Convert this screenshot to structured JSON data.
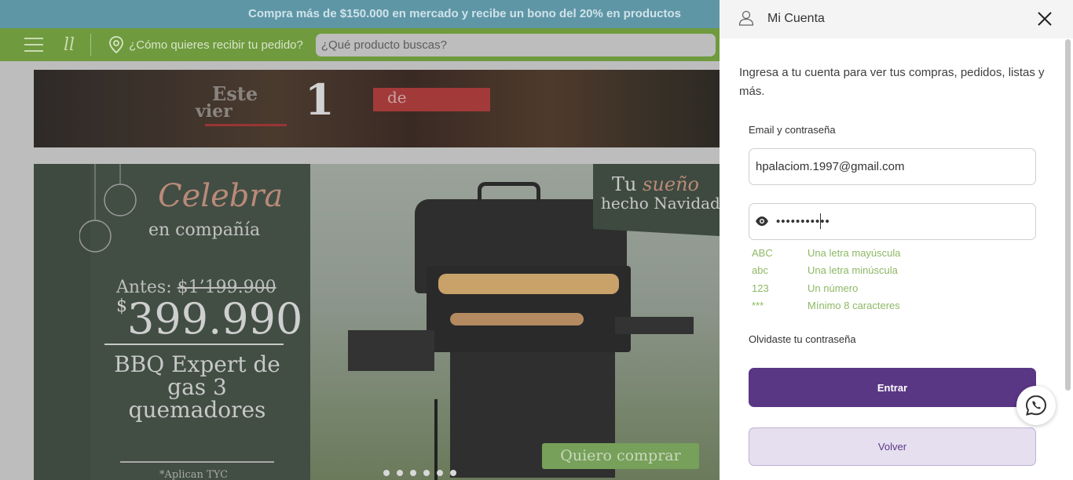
{
  "promo": {
    "text": "Compra más de $150.000 en mercado y recibe un bono del 20% en productos"
  },
  "nav": {
    "delivery_label": "¿Cómo quieres recibir tu pedido?",
    "search_placeholder": "¿Qué producto buscas?"
  },
  "banner_top": {
    "line1": "Este",
    "line2": "vier",
    "number": "1",
    "tag": "de"
  },
  "banner_main": {
    "headline": "Celebra",
    "subheadline": "en compañía",
    "before_label": "Antes:",
    "before_price": "$1’199.900",
    "price_symbol": "$",
    "price": "399.990",
    "product": "BBQ Expert de gas 3 quemadores",
    "terms": "*Aplican TYC",
    "ribbon_word1": "Tu",
    "ribbon_word2": "sueño",
    "ribbon_line2": "hecho Navidad",
    "cta": "Quiero comprar",
    "slide_count": 6
  },
  "account_panel": {
    "title": "Mi Cuenta",
    "intro": "Ingresa a tu cuenta para ver tus compras, pedidos, listas y más.",
    "credentials_label": "Email y contraseña",
    "email_value": "hpalaciom.1997@gmail.com",
    "password_value": "•••••••••••",
    "password_rules": [
      {
        "code": "ABC",
        "text": "Una letra mayúscula"
      },
      {
        "code": "abc",
        "text": "Una letra minúscula"
      },
      {
        "code": "123",
        "text": "Un número"
      },
      {
        "code": "***",
        "text": "Mínimo 8 caracteres"
      }
    ],
    "forgot_password": "Olvidaste tu contraseña",
    "submit_label": "Entrar",
    "back_label": "Volver"
  },
  "colors": {
    "primary": "#5a3785",
    "secondary_bg": "#e6dff0",
    "rule_ok": "#8db865",
    "promo_bar": "#5f96a6",
    "nav_bar": "#6f9a3e"
  },
  "icons": [
    "menu-icon",
    "brand-logo",
    "location-pin-icon",
    "user-icon",
    "close-icon",
    "eye-icon",
    "whatsapp-icon"
  ]
}
